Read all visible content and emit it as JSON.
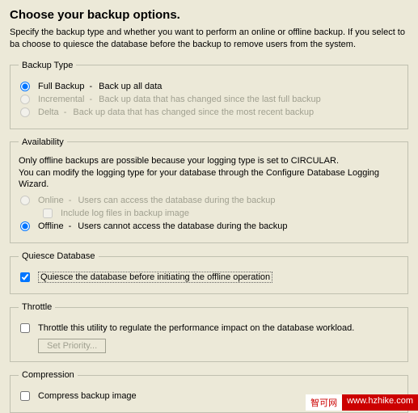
{
  "header": {
    "title": "Choose your backup options.",
    "subtitle": "Specify the backup type and whether you want to perform an online or offline backup. If you select to ba choose to quiesce the database before the backup to remove users from the system."
  },
  "backup_type": {
    "legend": "Backup Type",
    "full": {
      "label": "Full Backup",
      "desc": "Back up all data"
    },
    "incremental": {
      "label": "Incremental",
      "desc": "Back up data that has changed since the last full backup"
    },
    "delta": {
      "label": "Delta",
      "desc": "Back up data that has changed since the most recent backup"
    }
  },
  "availability": {
    "legend": "Availability",
    "info_line1": "Only offline backups are possible because your logging type is set to CIRCULAR.",
    "info_line2": "You can modify the logging type for your database through the Configure Database Logging Wizard.",
    "online": {
      "label": "Online",
      "desc": "Users can access the database during the backup"
    },
    "include_log": {
      "label": "Include log files in backup image"
    },
    "offline": {
      "label": "Offline",
      "desc": "Users cannot access the database during the backup"
    }
  },
  "quiesce": {
    "legend": "Quiesce Database",
    "checkbox": {
      "label": "Quiesce the database before initiating the offline operation"
    }
  },
  "throttle": {
    "legend": "Throttle",
    "checkbox": {
      "label": "Throttle this utility to regulate the performance impact on the database workload."
    },
    "button": "Set Priority..."
  },
  "compression": {
    "legend": "Compression",
    "checkbox": {
      "label": "Compress backup image"
    }
  },
  "watermark": {
    "left": "智可网",
    "right": "www.hzhike.com"
  }
}
